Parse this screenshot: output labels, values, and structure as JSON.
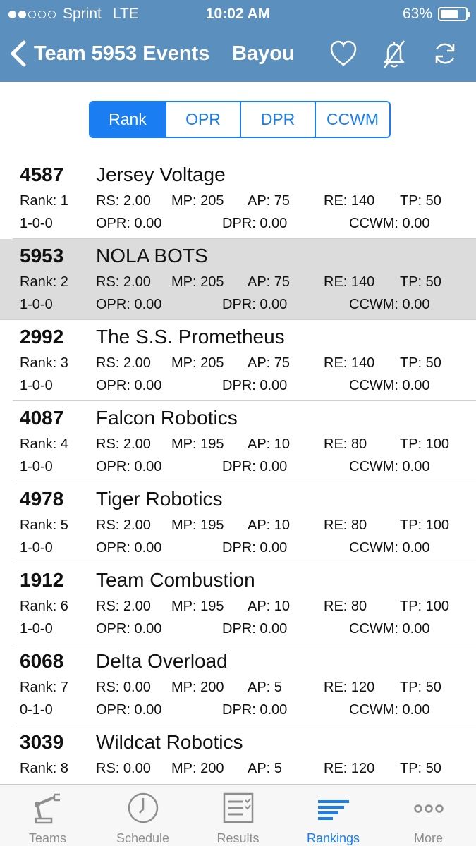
{
  "status": {
    "carrier": "Sprint",
    "network": "LTE",
    "time": "10:02 AM",
    "battery": "63%"
  },
  "nav": {
    "back_label": "Team 5953 Events",
    "title": "Bayou"
  },
  "segments": [
    {
      "label": "Rank",
      "active": true
    },
    {
      "label": "OPR",
      "active": false
    },
    {
      "label": "DPR",
      "active": false
    },
    {
      "label": "CCWM",
      "active": false
    }
  ],
  "teams": [
    {
      "number": "4587",
      "name": "Jersey Voltage",
      "rank": "Rank: 1",
      "rs": "RS: 2.00",
      "mp": "MP: 205",
      "ap": "AP: 75",
      "re": "RE: 140",
      "tp": "TP: 50",
      "record": "1-0-0",
      "opr": "OPR: 0.00",
      "dpr": "DPR: 0.00",
      "ccwm": "CCWM: 0.00"
    },
    {
      "number": "5953",
      "name": "NOLA BOTS",
      "rank": "Rank: 2",
      "rs": "RS: 2.00",
      "mp": "MP: 205",
      "ap": "AP: 75",
      "re": "RE: 140",
      "tp": "TP: 50",
      "record": "1-0-0",
      "opr": "OPR: 0.00",
      "dpr": "DPR: 0.00",
      "ccwm": "CCWM: 0.00"
    },
    {
      "number": "2992",
      "name": "The S.S. Prometheus",
      "rank": "Rank: 3",
      "rs": "RS: 2.00",
      "mp": "MP: 205",
      "ap": "AP: 75",
      "re": "RE: 140",
      "tp": "TP: 50",
      "record": "1-0-0",
      "opr": "OPR: 0.00",
      "dpr": "DPR: 0.00",
      "ccwm": "CCWM: 0.00"
    },
    {
      "number": "4087",
      "name": "Falcon Robotics",
      "rank": "Rank: 4",
      "rs": "RS: 2.00",
      "mp": "MP: 195",
      "ap": "AP: 10",
      "re": "RE: 80",
      "tp": "TP: 100",
      "record": "1-0-0",
      "opr": "OPR: 0.00",
      "dpr": "DPR: 0.00",
      "ccwm": "CCWM: 0.00"
    },
    {
      "number": "4978",
      "name": "Tiger Robotics",
      "rank": "Rank: 5",
      "rs": "RS: 2.00",
      "mp": "MP: 195",
      "ap": "AP: 10",
      "re": "RE: 80",
      "tp": "TP: 100",
      "record": "1-0-0",
      "opr": "OPR: 0.00",
      "dpr": "DPR: 0.00",
      "ccwm": "CCWM: 0.00"
    },
    {
      "number": "1912",
      "name": "Team Combustion",
      "rank": "Rank: 6",
      "rs": "RS: 2.00",
      "mp": "MP: 195",
      "ap": "AP: 10",
      "re": "RE: 80",
      "tp": "TP: 100",
      "record": "1-0-0",
      "opr": "OPR: 0.00",
      "dpr": "DPR: 0.00",
      "ccwm": "CCWM: 0.00"
    },
    {
      "number": "6068",
      "name": "Delta Overload",
      "rank": "Rank: 7",
      "rs": "RS: 0.00",
      "mp": "MP: 200",
      "ap": "AP: 5",
      "re": "RE: 120",
      "tp": "TP: 50",
      "record": "0-1-0",
      "opr": "OPR: 0.00",
      "dpr": "DPR: 0.00",
      "ccwm": "CCWM: 0.00"
    },
    {
      "number": "3039",
      "name": "Wildcat Robotics",
      "rank": "Rank: 8",
      "rs": "RS: 0.00",
      "mp": "MP: 200",
      "ap": "AP: 5",
      "re": "RE: 120",
      "tp": "TP: 50",
      "record": "",
      "opr": "",
      "dpr": "",
      "ccwm": ""
    }
  ],
  "tabs": [
    {
      "label": "Teams",
      "icon": "robot-arm-icon",
      "active": false
    },
    {
      "label": "Schedule",
      "icon": "clock-icon",
      "active": false
    },
    {
      "label": "Results",
      "icon": "results-list-icon",
      "active": false
    },
    {
      "label": "Rankings",
      "icon": "rankings-bars-icon",
      "active": true
    },
    {
      "label": "More",
      "icon": "more-dots-icon",
      "active": false
    }
  ],
  "colors": {
    "header": "#5b8fbe",
    "accent": "#1a7ef2",
    "highlight_row": "#dcdcdc",
    "tab_inactive": "#8e8e8e"
  }
}
